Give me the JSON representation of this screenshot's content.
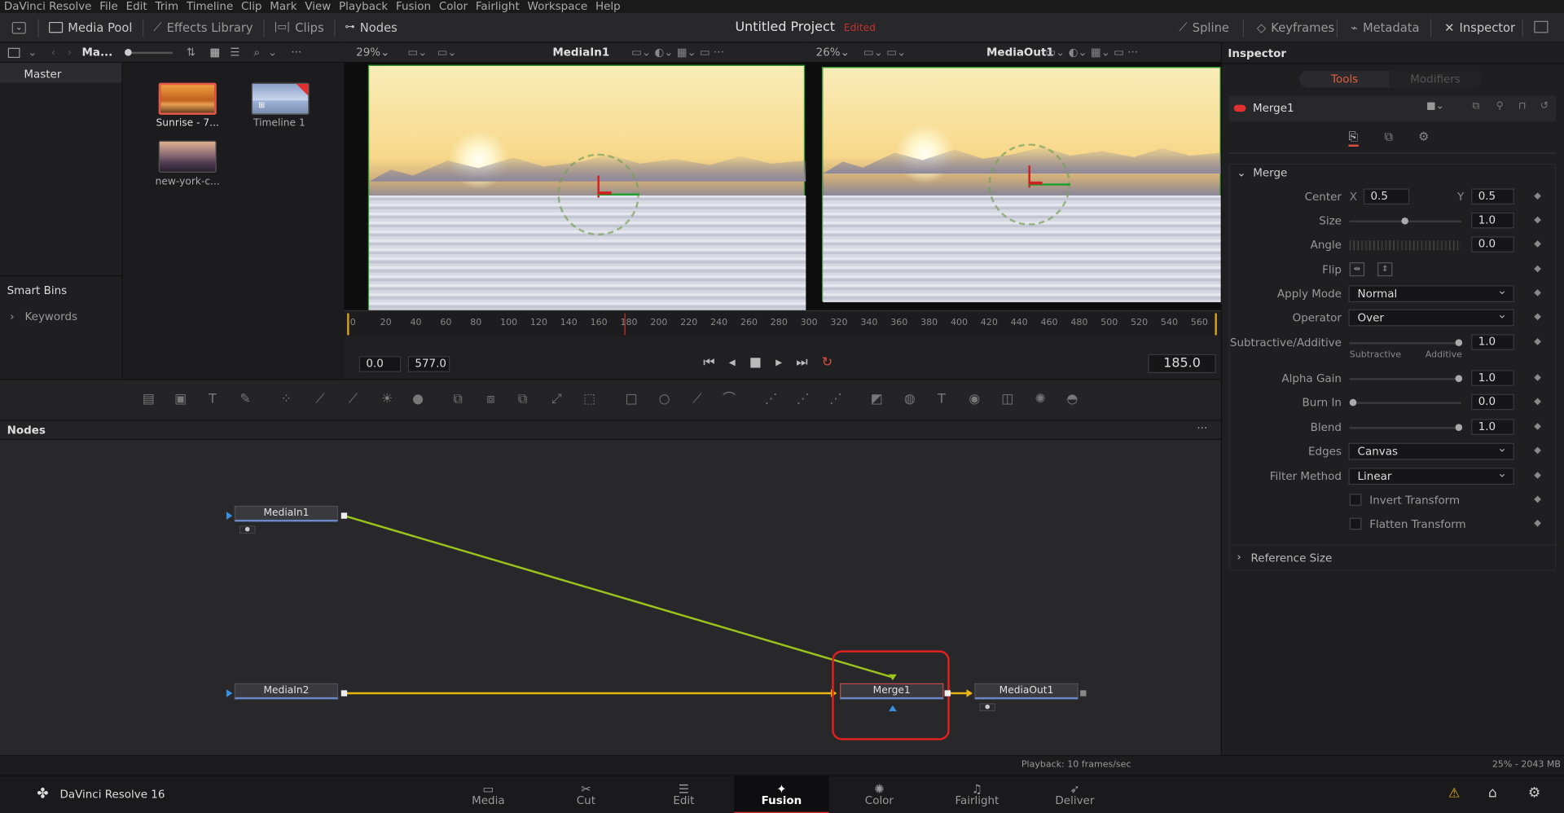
{
  "menu": [
    "DaVinci Resolve",
    "File",
    "Edit",
    "Trim",
    "Timeline",
    "Clip",
    "Mark",
    "View",
    "Playback",
    "Fusion",
    "Color",
    "Fairlight",
    "Workspace",
    "Help"
  ],
  "toolbar": {
    "media_pool": "Media Pool",
    "effects_library": "Effects Library",
    "clips": "Clips",
    "nodes": "Nodes",
    "project_title": "Untitled Project",
    "edited": "Edited",
    "spline": "Spline",
    "keyframes": "Keyframes",
    "metadata": "Metadata",
    "inspector": "Inspector"
  },
  "media_pool": {
    "bin_label": "Ma...",
    "master": "Master",
    "smart_bins": "Smart Bins",
    "keywords": "Keywords",
    "clips": [
      {
        "label": "Sunrise - 7..."
      },
      {
        "label": "Timeline 1"
      },
      {
        "label": "new-york-c..."
      }
    ]
  },
  "viewer1": {
    "zoom": "29%",
    "name": "MediaIn1"
  },
  "viewer2": {
    "zoom": "26%",
    "name": "MediaOut1"
  },
  "ruler_ticks": [
    "0",
    "20",
    "40",
    "60",
    "80",
    "100",
    "120",
    "140",
    "160",
    "180",
    "200",
    "220",
    "240",
    "260",
    "280",
    "300",
    "320",
    "340",
    "360",
    "380",
    "400",
    "420",
    "440",
    "460",
    "480",
    "500",
    "520",
    "540",
    "560"
  ],
  "transport": {
    "start": "0.0",
    "end": "577.0",
    "current": "185.0"
  },
  "nodes_panel": {
    "title": "Nodes"
  },
  "node_labels": {
    "mediain1": "MediaIn1",
    "mediain2": "MediaIn2",
    "merge1": "Merge1",
    "mediaout1": "MediaOut1"
  },
  "inspector": {
    "title": "Inspector",
    "tab_tools": "Tools",
    "tab_modifiers": "Modifiers",
    "tool_name": "Merge1",
    "section_merge": "Merge",
    "center_label": "Center",
    "x_label": "X",
    "y_label": "Y",
    "center_x": "0.5",
    "center_y": "0.5",
    "size_label": "Size",
    "size_value": "1.0",
    "angle_label": "Angle",
    "angle_value": "0.0",
    "flip_label": "Flip",
    "apply_mode_label": "Apply Mode",
    "apply_mode_value": "Normal",
    "operator_label": "Operator",
    "operator_value": "Over",
    "subadd_label": "Subtractive/Additive",
    "subadd_value": "1.0",
    "subtractive": "Subtractive",
    "additive": "Additive",
    "alpha_gain_label": "Alpha Gain",
    "alpha_gain_value": "1.0",
    "burn_in_label": "Burn In",
    "burn_in_value": "0.0",
    "blend_label": "Blend",
    "blend_value": "1.0",
    "edges_label": "Edges",
    "edges_value": "Canvas",
    "filter_label": "Filter Method",
    "filter_value": "Linear",
    "invert_transform": "Invert Transform",
    "flatten_transform": "Flatten Transform",
    "reference_size": "Reference Size"
  },
  "status": {
    "playback": "Playback: 10 frames/sec",
    "memory": "25% - 2043 MB"
  },
  "app_name": "DaVinci Resolve 16",
  "pages": [
    {
      "label": "Media",
      "icon": "media-icon"
    },
    {
      "label": "Cut",
      "icon": "cut-icon"
    },
    {
      "label": "Edit",
      "icon": "edit-icon"
    },
    {
      "label": "Fusion",
      "icon": "fusion-icon"
    },
    {
      "label": "Color",
      "icon": "color-icon"
    },
    {
      "label": "Fairlight",
      "icon": "fairlight-icon"
    },
    {
      "label": "Deliver",
      "icon": "deliver-icon"
    }
  ],
  "colors": {
    "accent_red": "#e83a3a",
    "node_selected": "#e02020",
    "link_green": "#9ac31c",
    "link_yellow": "#e8b512"
  }
}
